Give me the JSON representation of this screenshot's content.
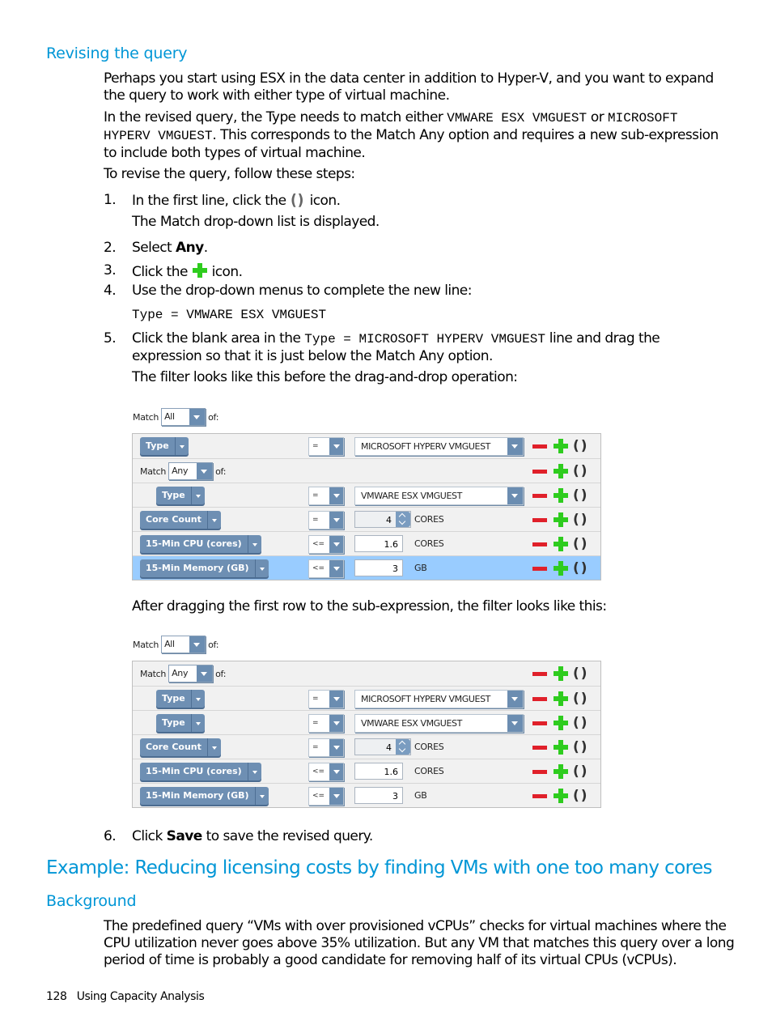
{
  "section1": {
    "heading": "Revising the query",
    "para1_line1": "Perhaps you start using ESX in the data center in addition to Hyper-V, and you want to expand",
    "para1_line2": "the query to work with either type of virtual machine.",
    "para2_pre": "In the revised query, the Type needs to match either ",
    "para2_code1": "VMWARE ESX VMGUEST",
    "para2_mid": " or ",
    "para2_code2a": "MICROSOFT",
    "para2_code2b": "HYPERV VMGUEST",
    "para2_post": ". This corresponds to the Match Any option and requires a new sub-expression",
    "para2_line3": "to include both types of virtual machine.",
    "para3": "To revise the query, follow these steps:"
  },
  "steps": [
    {
      "num": "1.",
      "pre": "In the first line, click the ",
      "icon": "parentheses-icon",
      "icon_text": "()",
      "post": " icon.",
      "note": "The Match drop-down list is displayed."
    },
    {
      "num": "2.",
      "pre": "Select ",
      "bold": "Any",
      "post": "."
    },
    {
      "num": "3.",
      "pre": "Click the ",
      "icon": "plus-icon",
      "post": " icon."
    },
    {
      "num": "4.",
      "text": "Use the drop-down menus to complete the new line:",
      "code": "Type = VMWARE ESX VMGUEST"
    },
    {
      "num": "5.",
      "pre": "Click the blank area in the ",
      "code": "Type = MICROSOFT HYPERV VMGUEST",
      "post": " line and drag the",
      "line2": "expression so that it is just below the Match Any option.",
      "note": "The filter looks like this before the drag-and-drop operation:"
    },
    {
      "num": "6.",
      "pre": "Click ",
      "bold": "Save",
      "post": " to save the revised query."
    }
  ],
  "after_drag_text": "After dragging the first row to the sub-expression, the filter looks like this:",
  "filter_common": {
    "match_label": "Match",
    "of_label": "of:",
    "match_all": "All",
    "match_any": "Any"
  },
  "filter_before": {
    "rows": [
      {
        "field": "Type",
        "op": "=",
        "value": "MICROSOFT HYPERV VMGUEST",
        "kind": "select",
        "indent": 0
      },
      {
        "kind": "submatch",
        "match": "Any"
      },
      {
        "field": "Type",
        "op": "=",
        "value": "VMWARE ESX VMGUEST",
        "kind": "select",
        "indent": 1
      },
      {
        "field": "Core Count",
        "op": "=",
        "value": "4",
        "unit": "CORES",
        "kind": "spin",
        "indent": 0
      },
      {
        "field": "15-Min CPU (cores)",
        "op": "<=",
        "value": "1.6",
        "unit": "CORES",
        "kind": "num",
        "indent": 0
      },
      {
        "field": "15-Min Memory (GB)",
        "op": "<=",
        "value": "3",
        "unit": "GB",
        "kind": "num",
        "indent": 0,
        "highlighted": true
      }
    ]
  },
  "filter_after": {
    "rows": [
      {
        "kind": "submatch",
        "match": "Any"
      },
      {
        "field": "Type",
        "op": "=",
        "value": "MICROSOFT HYPERV VMGUEST",
        "kind": "select",
        "indent": 1
      },
      {
        "field": "Type",
        "op": "=",
        "value": "VMWARE ESX VMGUEST",
        "kind": "select",
        "indent": 1
      },
      {
        "field": "Core Count",
        "op": "=",
        "value": "4",
        "unit": "CORES",
        "kind": "spin",
        "indent": 0
      },
      {
        "field": "15-Min CPU (cores)",
        "op": "<=",
        "value": "1.6",
        "unit": "CORES",
        "kind": "num",
        "indent": 0
      },
      {
        "field": "15-Min Memory (GB)",
        "op": "<=",
        "value": "3",
        "unit": "GB",
        "kind": "num",
        "indent": 0
      }
    ]
  },
  "example": {
    "heading": "Example: Reducing licensing costs by finding VMs with one too many cores",
    "subheading": "Background",
    "line1": "The predefined query “VMs with over provisioned vCPUs” checks for virtual machines where the",
    "line2": "CPU utilization never goes above 35% utilization. But any VM that matches this query over a long",
    "line3": "period of time is probably a good candidate for removing half of its virtual CPUs (vCPUs)."
  },
  "footer": {
    "page_number": "128",
    "title": "Using Capacity Analysis"
  }
}
